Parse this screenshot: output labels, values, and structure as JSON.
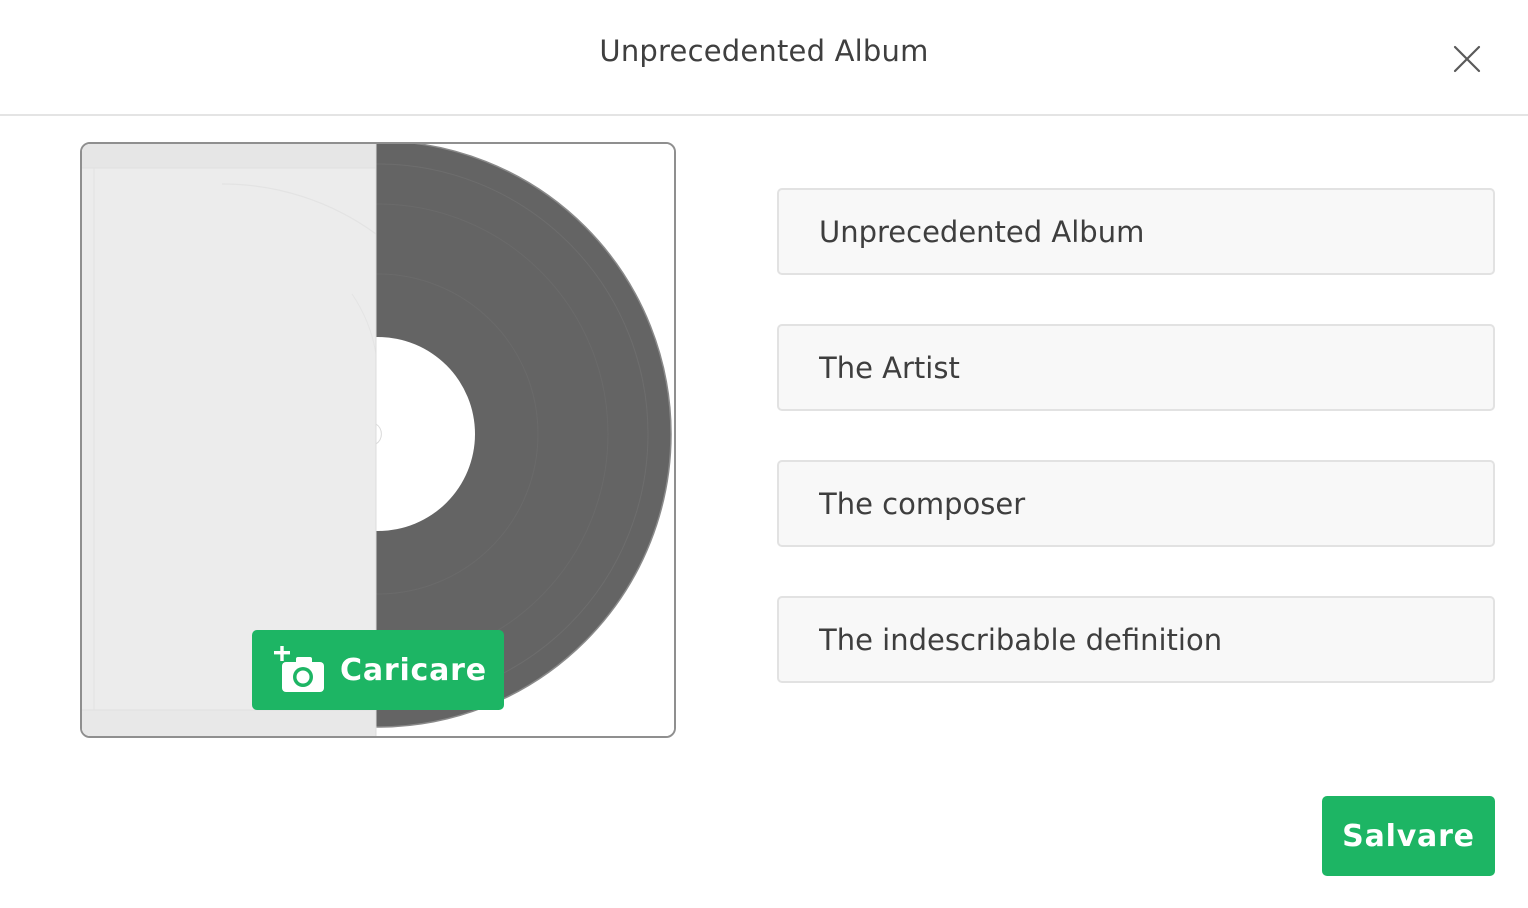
{
  "dialog": {
    "title": "Unprecedented Album",
    "close_icon": "close-icon"
  },
  "cover": {
    "image": "vinyl-record-in-sleeve",
    "upload_label": "Caricare",
    "upload_icon": "add-photo-camera-icon"
  },
  "form": {
    "album_title": "Unprecedented Album",
    "artist": "The Artist",
    "composer": "The composer",
    "definition": "The indescribable definition"
  },
  "actions": {
    "save_label": "Salvare"
  },
  "colors": {
    "accent": "#1db564",
    "vinyl": "#646464",
    "sleeve": "#ececec"
  }
}
